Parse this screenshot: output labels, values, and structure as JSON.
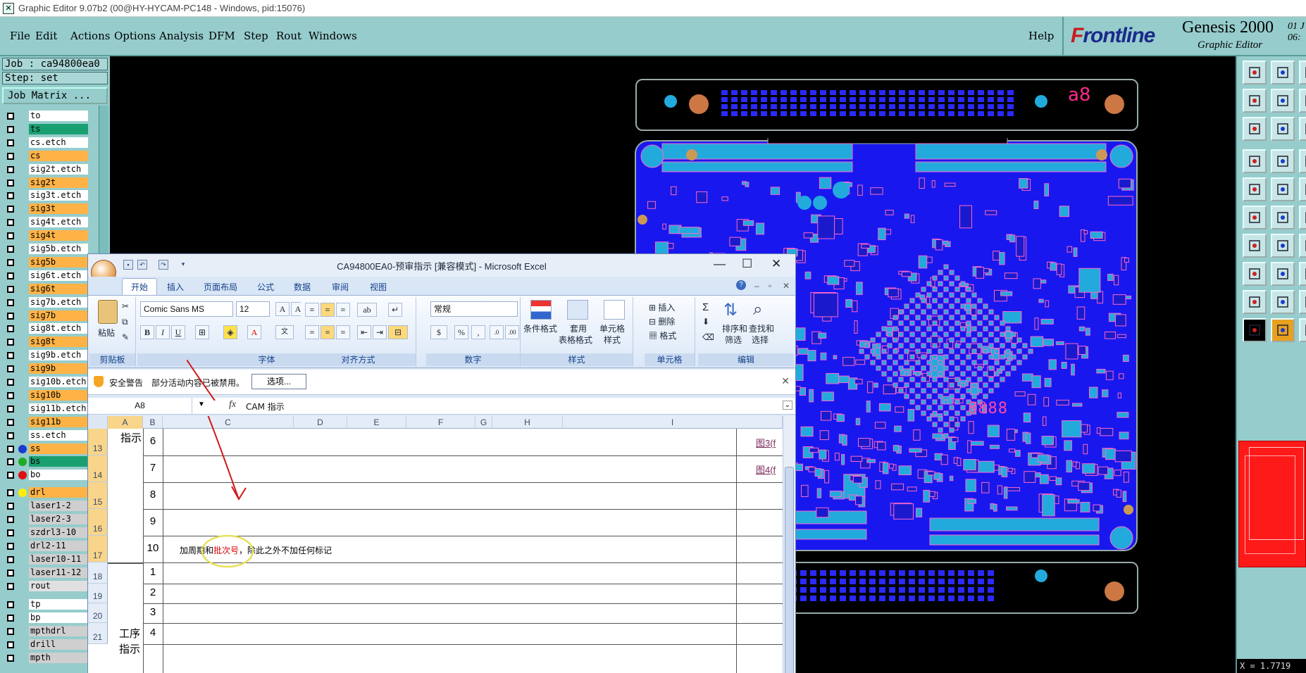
{
  "window": {
    "title": "Graphic Editor 9.07b2 (00@HY-HYCAM-PC148 - Windows, pid:15076)"
  },
  "menubar": {
    "items": [
      "File",
      "Edit",
      "Actions",
      "Options",
      "Analysis",
      "DFM",
      "Step",
      "Rout",
      "Windows"
    ],
    "help": "Help"
  },
  "logo": {
    "brand_first": "F",
    "brand_rest": "rontline",
    "product": "Genesis 2000",
    "subtitle": "Graphic Editor",
    "date_line1": "01 J",
    "date_line2": "06:"
  },
  "job_panel": {
    "job": "Job : ca94800ea0",
    "step": "Step: set",
    "matrix_button": "Job Matrix ..."
  },
  "layers": [
    {
      "name": "to",
      "color": "#ffffff"
    },
    {
      "name": "ts",
      "color": "#1aa070"
    },
    {
      "name": "cs.etch",
      "color": "#ffffff"
    },
    {
      "name": "cs",
      "color": "#ffb347"
    },
    {
      "name": "sig2t.etch",
      "color": "#ffffff"
    },
    {
      "name": "sig2t",
      "color": "#ffb347"
    },
    {
      "name": "sig3t.etch",
      "color": "#ffffff"
    },
    {
      "name": "sig3t",
      "color": "#ffb347"
    },
    {
      "name": "sig4t.etch",
      "color": "#ffffff"
    },
    {
      "name": "sig4t",
      "color": "#ffb347"
    },
    {
      "name": "sig5b.etch",
      "color": "#ffffff"
    },
    {
      "name": "sig5b",
      "color": "#ffb347"
    },
    {
      "name": "sig6t.etch",
      "color": "#ffffff"
    },
    {
      "name": "sig6t",
      "color": "#ffb347"
    },
    {
      "name": "sig7b.etch",
      "color": "#ffffff"
    },
    {
      "name": "sig7b",
      "color": "#ffb347"
    },
    {
      "name": "sig8t.etch",
      "color": "#ffffff"
    },
    {
      "name": "sig8t",
      "color": "#ffb347"
    },
    {
      "name": "sig9b.etch",
      "color": "#ffffff"
    },
    {
      "name": "sig9b",
      "color": "#ffb347"
    },
    {
      "name": "sig10b.etch",
      "color": "#ffffff"
    },
    {
      "name": "sig10b",
      "color": "#ffb347"
    },
    {
      "name": "sig11b.etch",
      "color": "#ffffff"
    },
    {
      "name": "sig11b",
      "color": "#ffb347"
    },
    {
      "name": "ss.etch",
      "color": "#ffffff"
    },
    {
      "name": "ss",
      "color": "#ffb347",
      "dot": "#1a3ad0"
    },
    {
      "name": "bs",
      "color": "#1aa070",
      "dot": "#22aa22"
    },
    {
      "name": "bo",
      "color": "#ffffff",
      "dot": "#dd1111"
    },
    {
      "name": "drl",
      "color": "#ffb347",
      "dot": "#ffee00"
    },
    {
      "name": "laser1-2",
      "color": "#cfcfcf"
    },
    {
      "name": "laser2-3",
      "color": "#cfcfcf"
    },
    {
      "name": "szdrl3-10",
      "color": "#cfcfcf"
    },
    {
      "name": "drl2-11",
      "color": "#cfcfcf"
    },
    {
      "name": "laser10-11",
      "color": "#cfcfcf"
    },
    {
      "name": "laser11-12",
      "color": "#cfcfcf"
    },
    {
      "name": "rout",
      "color": "#e0e0e0"
    },
    {
      "name": "tp",
      "color": "#ffffff"
    },
    {
      "name": "bp",
      "color": "#ffffff"
    },
    {
      "name": "mpthdrl",
      "color": "#cfcfcf"
    },
    {
      "name": "drill",
      "color": "#cfcfcf"
    },
    {
      "name": "mpth",
      "color": "#cfcfcf"
    }
  ],
  "board": {
    "silk_text": "a8",
    "bottom_text": "8888"
  },
  "excel": {
    "title": "CA94800EA0-预审指示  [兼容模式] - Microsoft Excel",
    "tabs": [
      "开始",
      "插入",
      "页面布局",
      "公式",
      "数据",
      "审阅",
      "视图"
    ],
    "ribbon": {
      "clipboard": {
        "paste": "粘贴",
        "label": "剪贴板"
      },
      "font": {
        "name": "Comic Sans MS",
        "size": "12",
        "label": "字体"
      },
      "align": {
        "label": "对齐方式"
      },
      "number": {
        "format": "常规",
        "label": "数字"
      },
      "styles": {
        "cond": "条件格式",
        "table_a": "套用",
        "table_b": "表格格式",
        "cell_a": "单元格",
        "cell_b": "样式",
        "label": "样式"
      },
      "cells": {
        "insert": "插入",
        "delete": "删除",
        "format": "格式",
        "label": "单元格"
      },
      "editing": {
        "sort_a": "排序和",
        "sort_b": "筛选",
        "find_a": "查找和",
        "find_b": "选择",
        "label": "编辑"
      }
    },
    "warning": {
      "title": "安全警告",
      "message": "部分活动内容已被禁用。",
      "options": "选项..."
    },
    "formula": {
      "namebox": "A8",
      "fx": "fx",
      "value": "CAM  指示"
    },
    "columns": [
      "A",
      "B",
      "C",
      "D",
      "E",
      "F",
      "G",
      "H",
      "I"
    ],
    "rows": [
      "13",
      "14",
      "15",
      "16",
      "17",
      "18",
      "19",
      "20",
      "21"
    ],
    "section1_label": "指示",
    "section2_label_a": "工序",
    "section2_label_b": "指示",
    "seq": [
      "6",
      "7",
      "8",
      "9",
      "10",
      "1",
      "2",
      "3",
      "4"
    ],
    "text_row16_a": "加周期和",
    "text_row16_b": "批次号",
    "text_row16_c": "，除此之外不加任何标记",
    "link_row13": "图3(f",
    "link_row14": "图4(f"
  },
  "coord": "X = 1.7719"
}
